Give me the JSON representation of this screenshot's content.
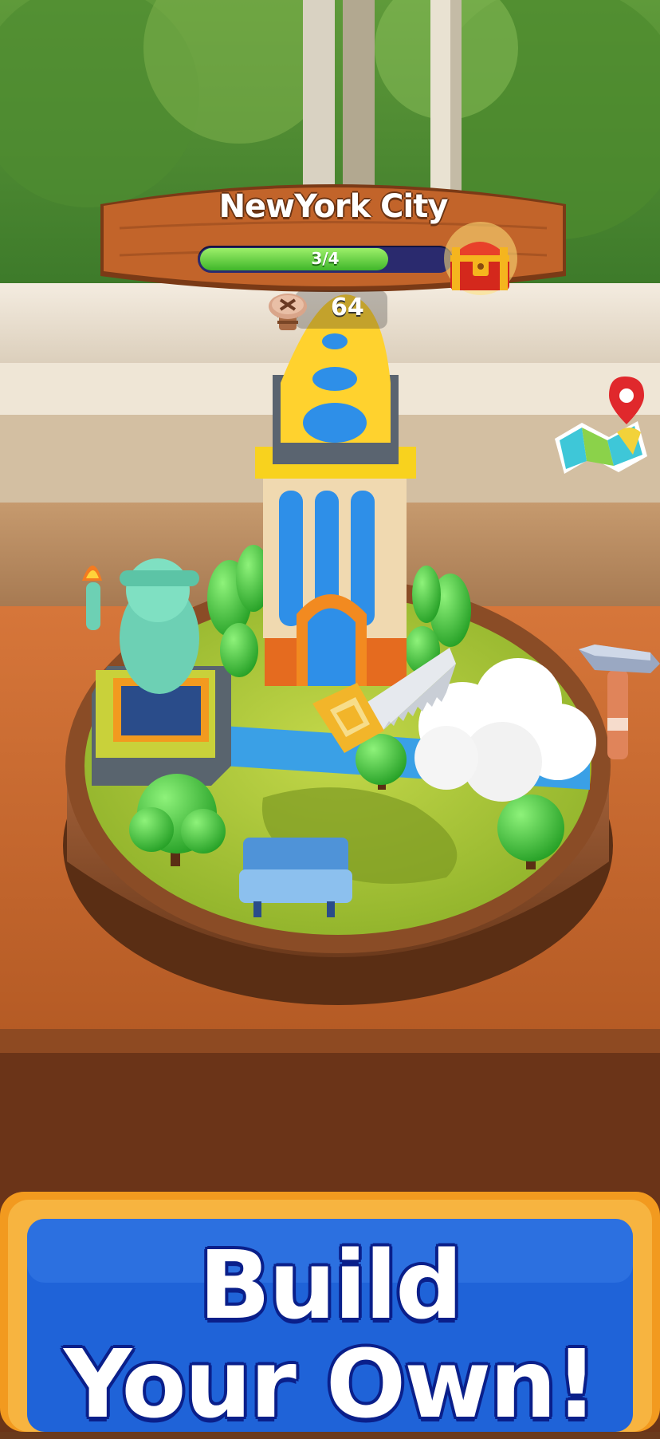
{
  "level": {
    "city_name": "NewYork City",
    "progress_text": "3/4",
    "progress_value": 0.75
  },
  "counter": {
    "value": "64",
    "icon": "screw-icon"
  },
  "tools": {
    "map": "map-icon",
    "hammer": "hammer-icon",
    "saw": "saw-icon"
  },
  "banner": {
    "line1": "Build",
    "line2": "Your Own!"
  },
  "colors": {
    "banner_wood": "#c2642a",
    "progress_green": "#3fb62a",
    "panel_blue": "#1f63d8",
    "panel_orange": "#f29a1f",
    "text_outline": "#0a1f8a"
  }
}
